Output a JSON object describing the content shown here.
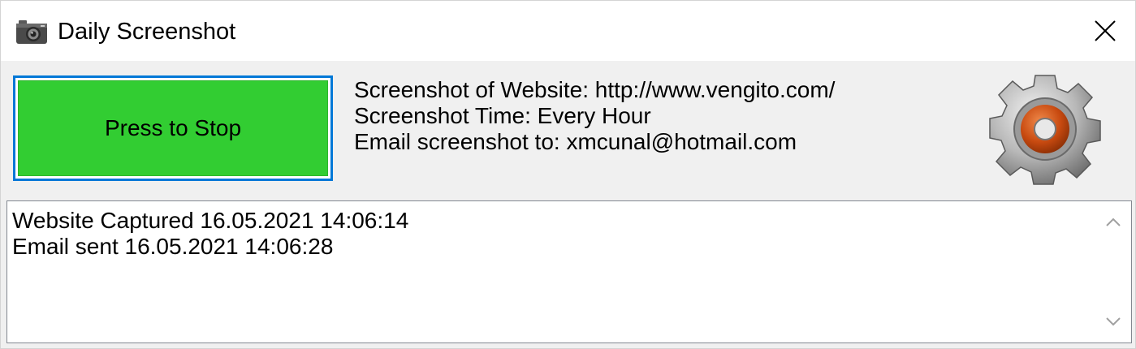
{
  "window": {
    "title": "Daily Screenshot",
    "app_icon": "camera-icon",
    "close_icon": "close-icon"
  },
  "controls": {
    "stop_button_label": "Press to Stop",
    "stop_button_color": "#32cd32",
    "focus_border_color": "#0078d7",
    "settings_icon": "gear-icon"
  },
  "info": {
    "website_line": "Screenshot of Website: http://www.vengito.com/",
    "time_line": "Screenshot Time: Every Hour",
    "email_line": "Email screenshot to: xmcunal@hotmail.com"
  },
  "log": {
    "lines": [
      "Website Captured 16.05.2021 14:06:14",
      "Email sent 16.05.2021 14:06:28"
    ]
  }
}
